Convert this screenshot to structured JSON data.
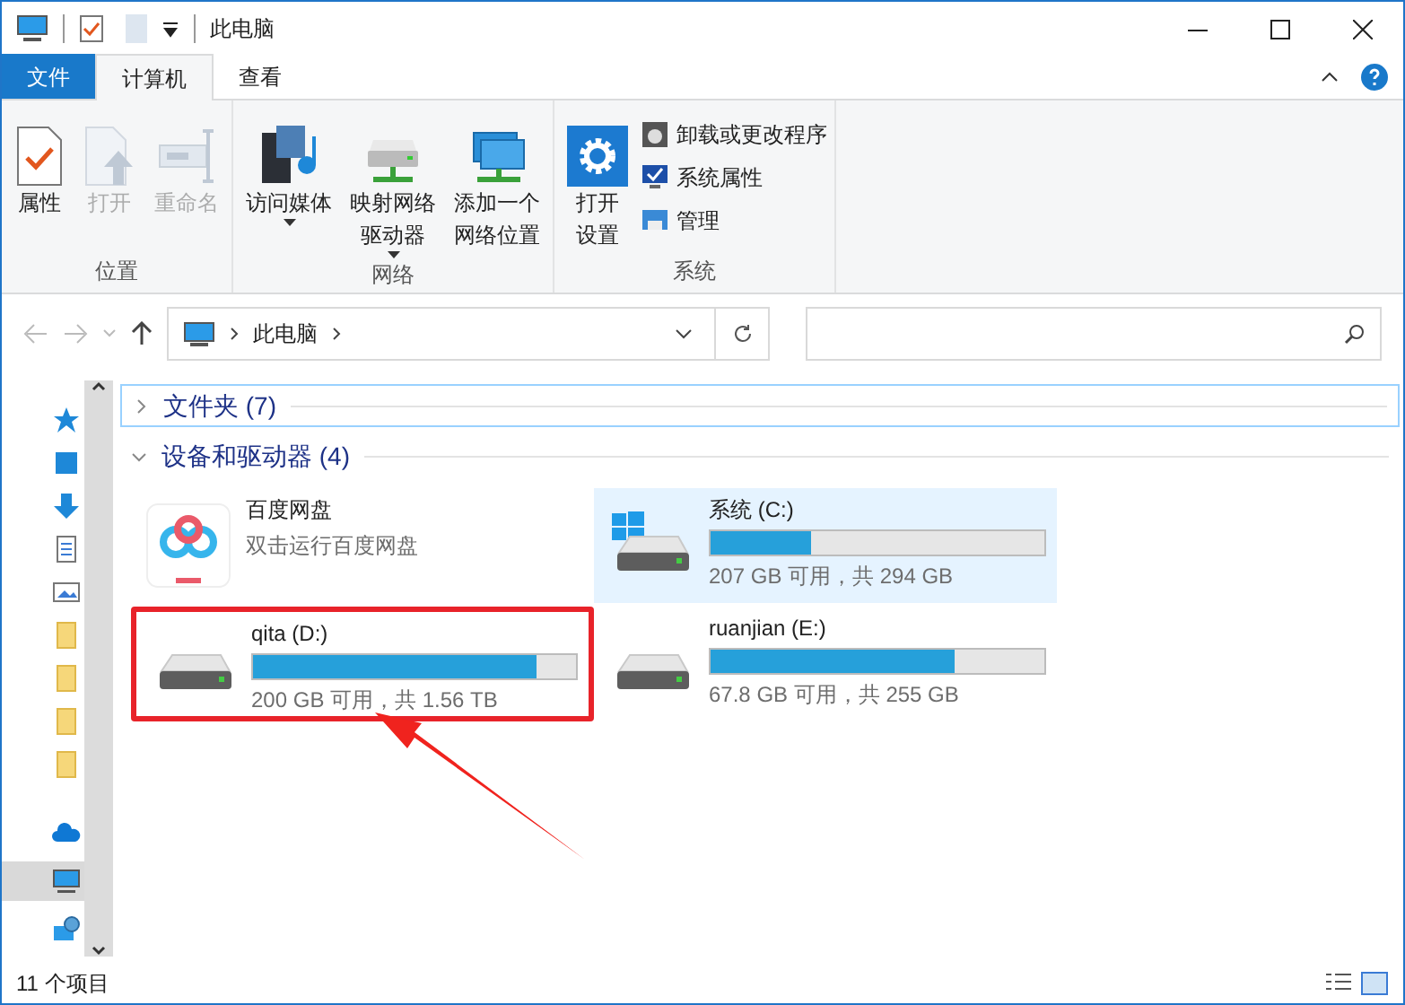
{
  "window": {
    "title": "此电脑"
  },
  "tabs": [
    {
      "label": "文件",
      "kind": "file",
      "selected": false
    },
    {
      "label": "计算机",
      "kind": "tab",
      "selected": true
    },
    {
      "label": "查看",
      "kind": "tab",
      "selected": false
    }
  ],
  "ribbon": {
    "groups": [
      {
        "label": "位置",
        "buttons": [
          {
            "label": "属性",
            "kind": "properties",
            "disabled": false,
            "dropdown": false
          },
          {
            "label": "打开",
            "kind": "open",
            "disabled": true,
            "dropdown": false
          },
          {
            "label": "重命名",
            "kind": "rename",
            "disabled": true,
            "dropdown": false
          }
        ]
      },
      {
        "label": "网络",
        "buttons": [
          {
            "label": "访问媒体",
            "kind": "media",
            "disabled": false,
            "dropdown": true
          },
          {
            "label": [
              "映射网络",
              "驱动器"
            ],
            "kind": "map-drive",
            "disabled": false,
            "dropdown": true
          },
          {
            "label": [
              "添加一个",
              "网络位置"
            ],
            "kind": "network-location",
            "disabled": false,
            "dropdown": false
          }
        ]
      },
      {
        "label": "系统",
        "buttons": [
          {
            "label": [
              "打开",
              "设置"
            ],
            "kind": "settings",
            "disabled": false,
            "dropdown": false
          }
        ],
        "small_buttons": [
          {
            "label": "卸载或更改程序",
            "kind": "uninstall"
          },
          {
            "label": "系统属性",
            "kind": "system-properties"
          },
          {
            "label": "管理",
            "kind": "manage"
          }
        ]
      }
    ]
  },
  "address_bar": {
    "path": [
      "此电脑"
    ]
  },
  "nav_pane": {
    "items": [
      {
        "kind": "quick-access",
        "selected": false
      },
      {
        "kind": "desktop",
        "selected": false
      },
      {
        "kind": "downloads",
        "selected": false
      },
      {
        "kind": "documents",
        "selected": false
      },
      {
        "kind": "pictures",
        "selected": false
      },
      {
        "kind": "folder",
        "selected": false
      },
      {
        "kind": "folder",
        "selected": false
      },
      {
        "kind": "folder",
        "selected": false
      },
      {
        "kind": "folder",
        "selected": false
      },
      {
        "kind": "onedrive",
        "selected": false
      },
      {
        "kind": "this-pc",
        "selected": true
      },
      {
        "kind": "network",
        "selected": false
      }
    ]
  },
  "sections": [
    {
      "title": "文件夹 (7)",
      "expanded": false
    },
    {
      "title": "设备和驱动器 (4)",
      "expanded": true,
      "items": [
        {
          "kind": "app",
          "name": "百度网盘",
          "detail": "双击运行百度网盘",
          "selected": false,
          "highlighted": false
        },
        {
          "kind": "system-drive",
          "name": "系统 (C:)",
          "level": 0.3,
          "detail": "207 GB 可用，共 294 GB",
          "selected": true,
          "highlighted": false
        },
        {
          "kind": "drive",
          "name": "qita (D:)",
          "level": 0.88,
          "detail": "200 GB 可用，共 1.56 TB",
          "selected": false,
          "highlighted": true
        },
        {
          "kind": "drive",
          "name": "ruanjian (E:)",
          "level": 0.73,
          "detail": "67.8 GB 可用，共 255 GB",
          "selected": false,
          "highlighted": false
        }
      ]
    }
  ],
  "status_bar": {
    "text": "11 个项目"
  }
}
